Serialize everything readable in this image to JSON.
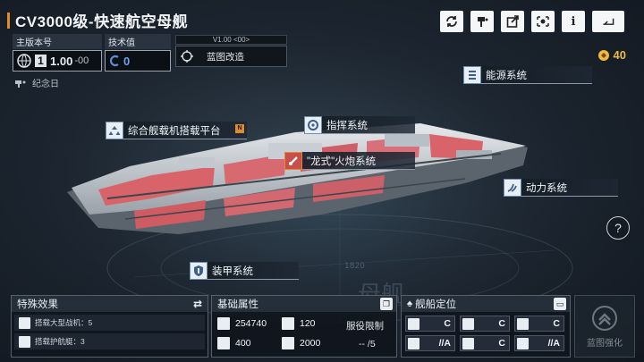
{
  "ship": {
    "title": "CV3000级-快速航空母舰",
    "version_label": "主版本号",
    "version_index": "1",
    "version_value": "1.00",
    "version_suffix": "-00",
    "tech_label": "技术值",
    "tech_value": "0",
    "blueprint_version": "V1.00 <00>",
    "blueprint_label": "蓝图改造",
    "memorial_label": "纪念日"
  },
  "currency": {
    "value": "40",
    "color": "#f0b845"
  },
  "toolbar": {
    "buttons": [
      "refresh-icon",
      "paint-icon",
      "share-icon",
      "view-icon",
      "info-icon",
      "exit-icon"
    ],
    "info_glyph": "i"
  },
  "systems": {
    "energy": "能源系统",
    "command": "指挥系统",
    "carrier": "综合舰载机搭载平台",
    "gun": "\"龙式\"火炮系统",
    "power": "动力系统",
    "armor": "装甲系统",
    "carrier_badge": "N"
  },
  "watermark": {
    "number": "1820",
    "text": "母舰"
  },
  "special_effects": {
    "title": "特殊效果",
    "items": [
      "搭载大型战机：5",
      "搭载护航艇：3"
    ]
  },
  "base_attrs": {
    "title": "基础属性",
    "hp": "254740",
    "armor": "120",
    "speed": "400",
    "range": "2000",
    "service_label": "服役限制",
    "service_value": "-- /5"
  },
  "positioning": {
    "title": "舰船定位",
    "cells": [
      "C",
      "C",
      "C",
      "//A",
      "C",
      "//A"
    ]
  },
  "enhance": {
    "label": "蓝图强化"
  },
  "help": {
    "glyph": "?"
  },
  "colors": {
    "accent": "#e08a2c",
    "ship_red": "#d8646a",
    "panel_bg": "#10161d"
  }
}
